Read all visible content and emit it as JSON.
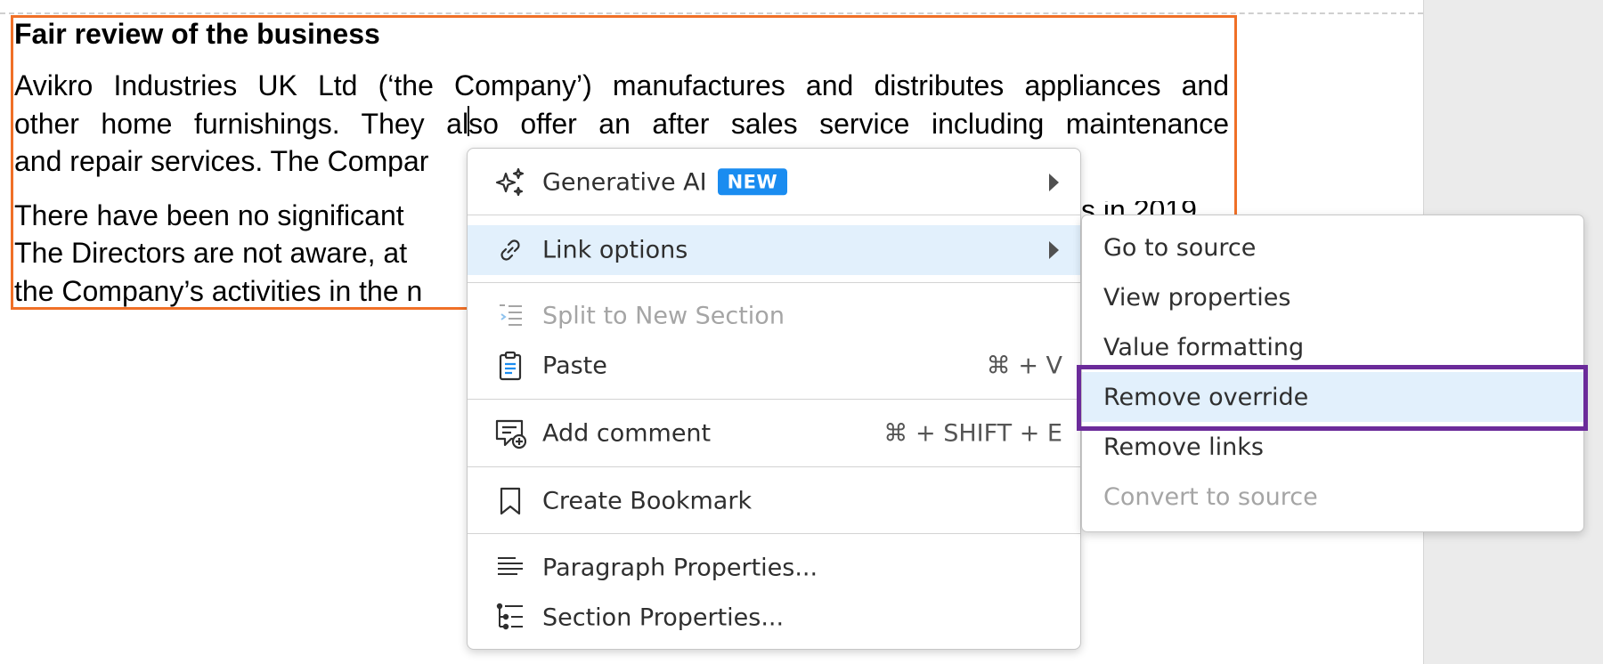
{
  "document": {
    "heading": "Fair review of the business",
    "paragraph1": [
      "Avikro Industries UK Ltd (‘the Company’) manufactures and distributes appliances and",
      "other home furnishings. They also offer an after sales service including maintenance",
      "and repair services. The Compar"
    ],
    "paragraph2": [
      "There have been no significant",
      "The Directors are not aware, at",
      "the Company’s activities in the n"
    ],
    "behind_menu_fragment": "s in 2019"
  },
  "context_menu": {
    "items": [
      {
        "label": "Generative AI",
        "badge": "NEW",
        "icon": "sparkle-icon",
        "has_submenu": true
      },
      {
        "label": "Link options",
        "icon": "link-icon",
        "has_submenu": true,
        "highlighted": true
      },
      {
        "label": "Split to New Section",
        "icon": "split-section-icon",
        "disabled": true
      },
      {
        "label": "Paste",
        "icon": "clipboard-icon",
        "shortcut": "⌘ + V"
      },
      {
        "label": "Add comment",
        "icon": "add-comment-icon",
        "shortcut": "⌘ + SHIFT + E"
      },
      {
        "label": "Create Bookmark",
        "icon": "bookmark-icon"
      },
      {
        "label": "Paragraph Properties...",
        "icon": "paragraph-icon"
      },
      {
        "label": "Section Properties...",
        "icon": "section-list-icon"
      }
    ]
  },
  "link_submenu": {
    "items": [
      {
        "label": "Go to source"
      },
      {
        "label": "View properties"
      },
      {
        "label": "Value formatting"
      },
      {
        "label": "Remove override",
        "highlighted": true
      },
      {
        "label": "Remove links"
      },
      {
        "label": "Convert to source",
        "disabled": true
      }
    ]
  },
  "colors": {
    "section_border": "#f07027",
    "highlight": "#e2f0fc",
    "badge": "#1a8cf0",
    "focus_outline": "#6b2b9a"
  }
}
